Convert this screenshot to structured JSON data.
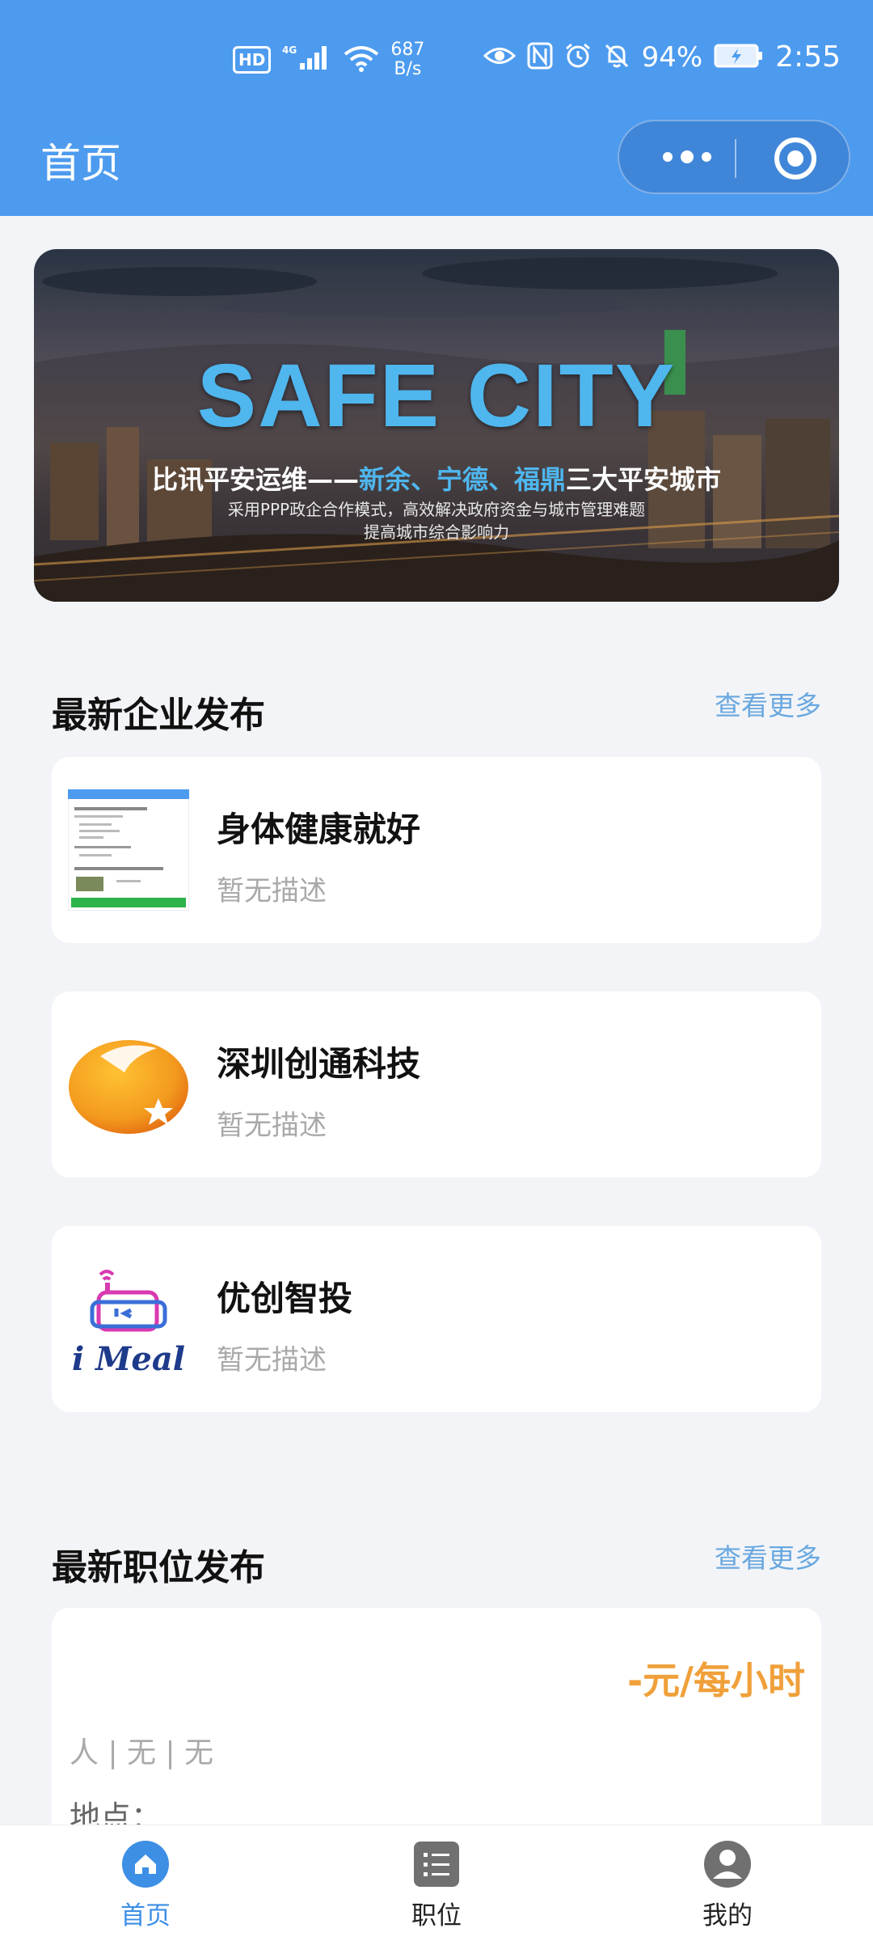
{
  "status_bar": {
    "left_badges": [
      "HD",
      "4G"
    ],
    "speed_value": "687",
    "speed_unit": "B/s",
    "battery": "94%",
    "time": "2:55",
    "icons": [
      "eye-icon",
      "nfc-icon",
      "alarm-icon",
      "bell-off-icon",
      "battery-charging-icon",
      "signal-icon",
      "wifi-icon"
    ]
  },
  "nav": {
    "title": "首页",
    "capsule": [
      "more-icon",
      "close-target-icon"
    ]
  },
  "banner": {
    "title": "SAFE CITY",
    "line1_prefix": "比讯平安运维——",
    "line1_highlight": "新余、宁德、福鼎",
    "line1_suffix": "三大平安城市",
    "line2": "采用PPP政企合作模式，高效解决政府资金与城市管理难题",
    "line3": "提高城市综合影响力"
  },
  "companies_section": {
    "title": "最新企业发布",
    "more": "查看更多",
    "items": [
      {
        "name": "身体健康就好",
        "desc": "暂无描述",
        "thumb": "screenshot-thumb"
      },
      {
        "name": "深圳创通科技",
        "desc": "暂无描述",
        "thumb": "orange-star-logo"
      },
      {
        "name": "优创智投",
        "desc": "暂无描述",
        "thumb": "imeal-logo",
        "logo_text": "i Meal"
      }
    ]
  },
  "jobs_section": {
    "title": "最新职位发布",
    "more": "查看更多",
    "items": [
      {
        "salary": "-元/每小时",
        "meta": "人 | 无 | 无",
        "location": "地点："
      }
    ]
  },
  "tabbar": {
    "items": [
      {
        "label": "首页",
        "icon": "home-icon",
        "active": true
      },
      {
        "label": "职位",
        "icon": "list-icon",
        "active": false
      },
      {
        "label": "我的",
        "icon": "user-icon",
        "active": false
      }
    ]
  },
  "colors": {
    "primary": "#4d9bef",
    "accent_more": "#6aa8e0",
    "salary": "#f0a03a",
    "muted": "#a9a9a9"
  }
}
